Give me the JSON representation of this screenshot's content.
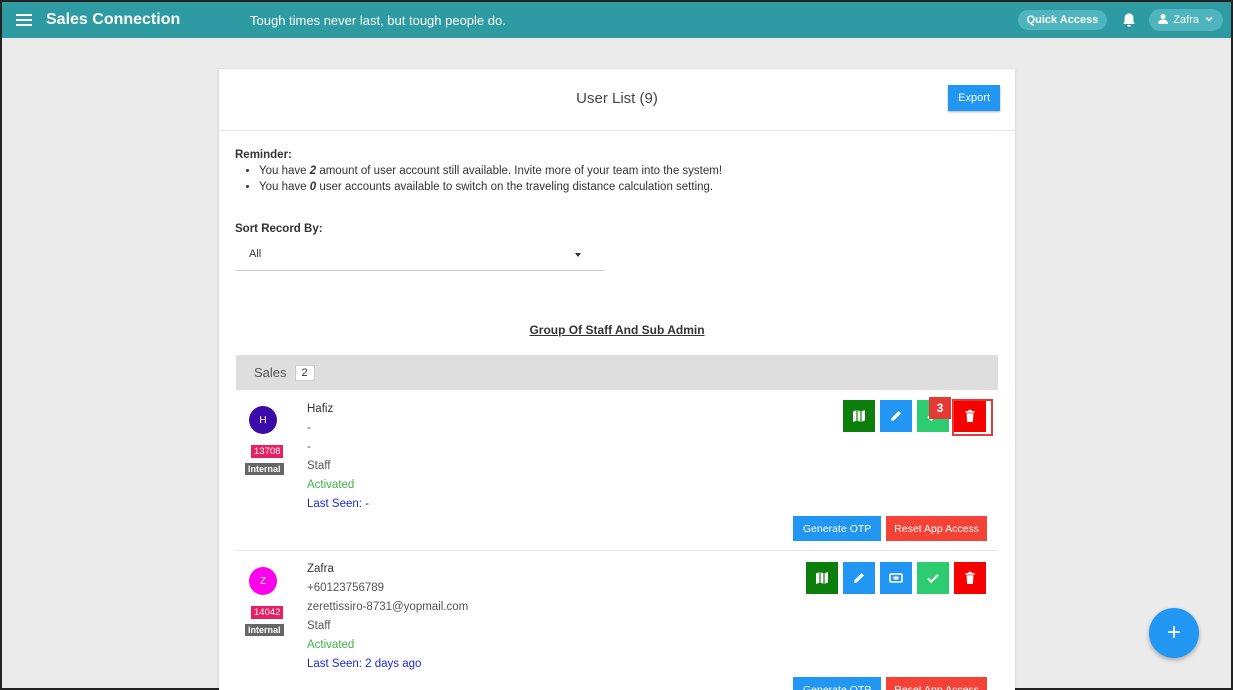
{
  "topbar": {
    "brand": "Sales Connection",
    "tagline": "Tough times never last, but tough people do.",
    "quick_access": "Quick Access",
    "user_name": "Zafra"
  },
  "card": {
    "title": "User List (9)",
    "export_label": "Export"
  },
  "reminder": {
    "title": "Reminder:",
    "line1_pre": "You have ",
    "line1_num": "2",
    "line1_post": " amount of user account still available. Invite more of your team into the system!",
    "line2_pre": "You have ",
    "line2_num": "0",
    "line2_post": " user accounts available to switch on the traveling distance calculation setting."
  },
  "sort": {
    "label": "Sort Record By:",
    "value": "All"
  },
  "group_title": "Group Of Staff And Sub Admin",
  "group": {
    "name": "Sales",
    "count": "2"
  },
  "users": [
    {
      "initial": "H",
      "id": "13708",
      "type": "Internal",
      "name": "Hafiz",
      "phone": "-",
      "email": "-",
      "role": "Staff",
      "status": "Activated",
      "last_seen": "Last Seen: -",
      "avatar_color": "#3b0aa8"
    },
    {
      "initial": "Z",
      "id": "14042",
      "type": "Internal",
      "name": "Zafra",
      "phone": "+60123756789",
      "email": "zerettissiro-8731@yopmail.com",
      "role": "Staff",
      "status": "Activated",
      "last_seen": "Last Seen: 2 days ago",
      "avatar_color": "#ff00ee"
    }
  ],
  "buttons": {
    "generate_otp": "Generate OTP",
    "reset_app_access": "Reset App Access"
  },
  "annotation": {
    "number": "3"
  },
  "fab_label": "+",
  "colors": {
    "topbar": "#2e9aa2",
    "accent_blue": "#2196f3",
    "danger": "#f60000",
    "map_green": "#0c7e0c",
    "check_green": "#2ecc71"
  }
}
